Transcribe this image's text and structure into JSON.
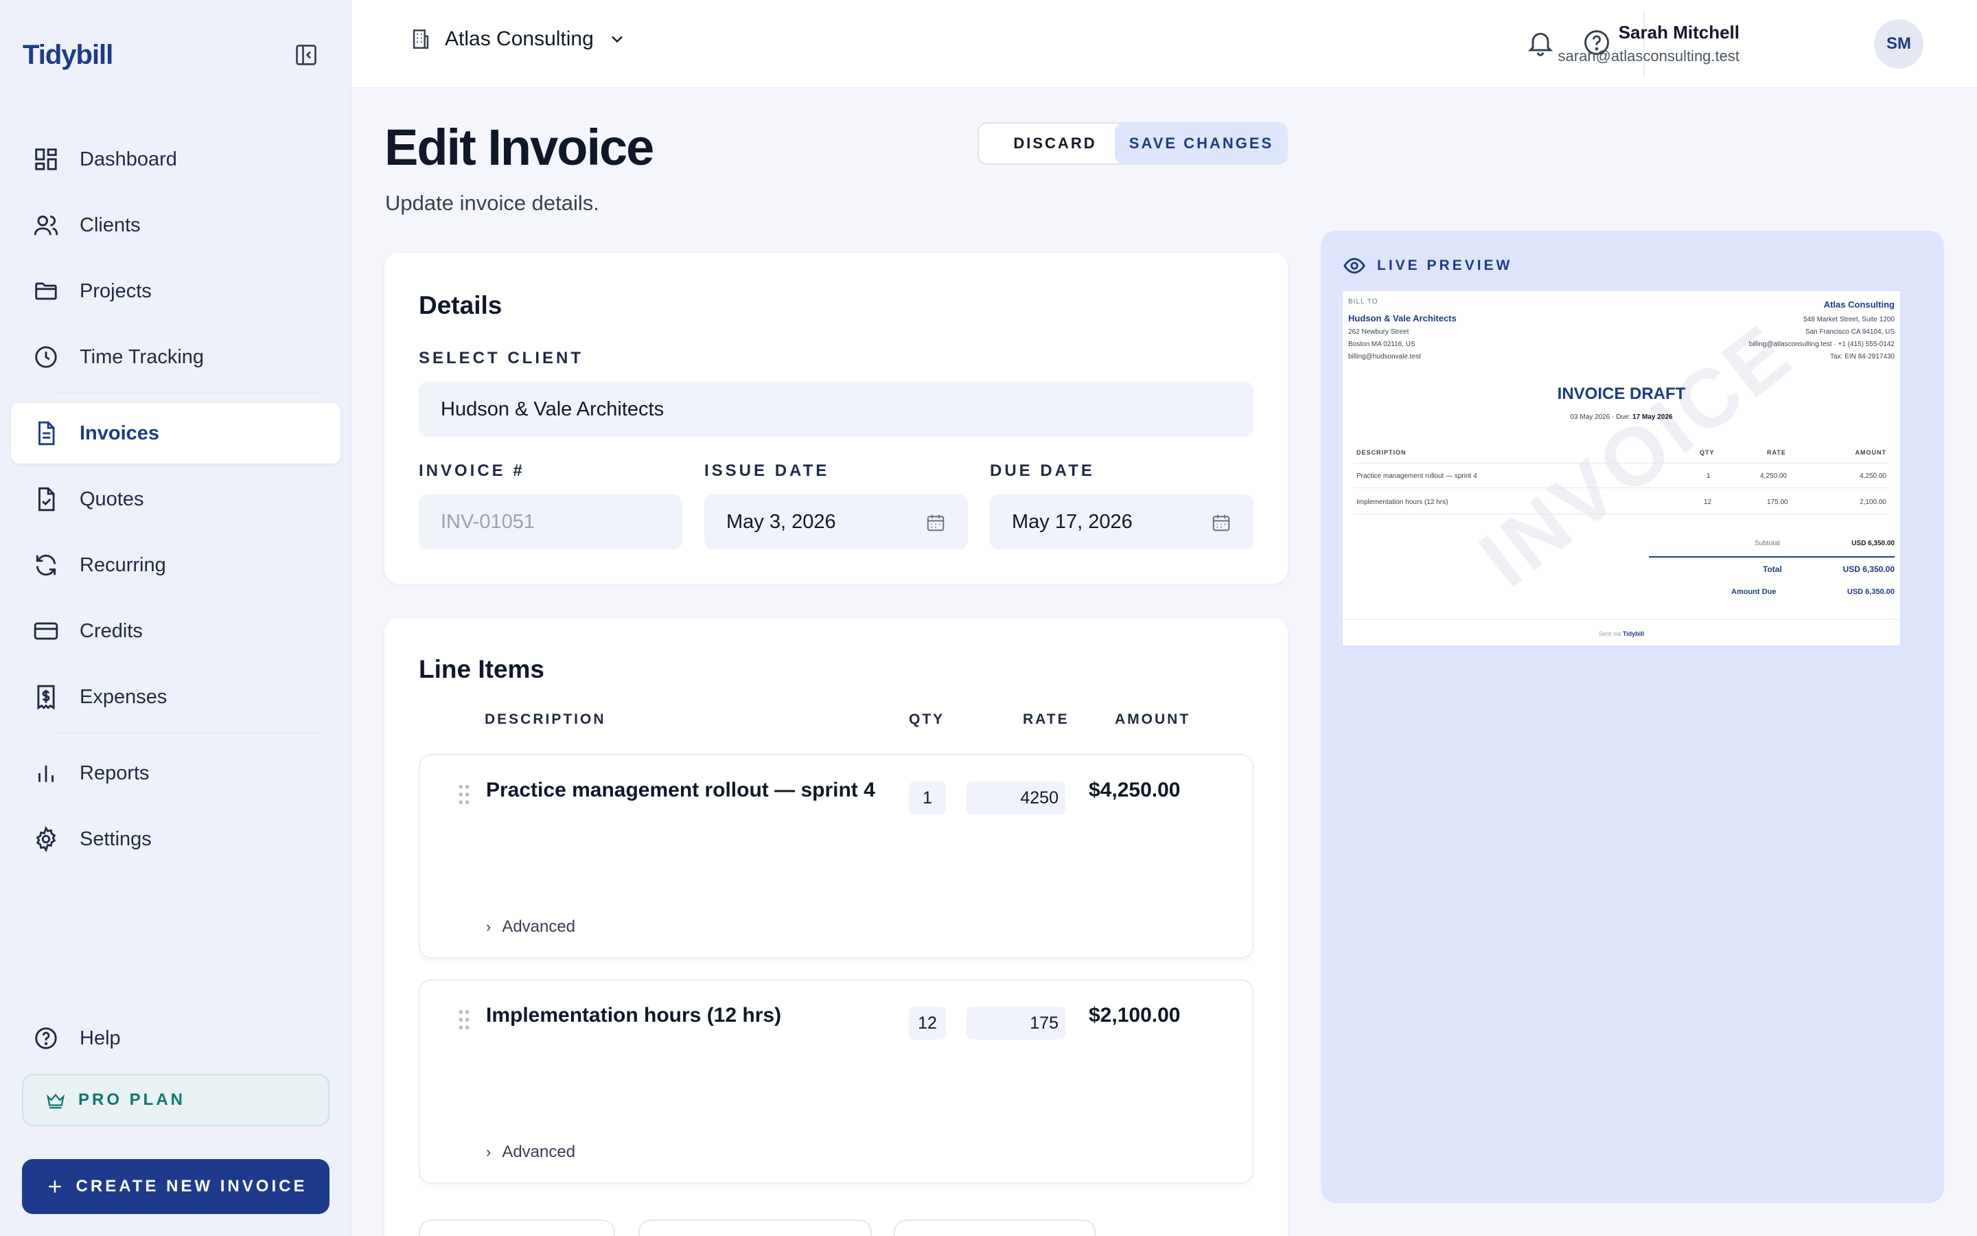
{
  "brand": "Tidybill",
  "sidebar": {
    "items": [
      {
        "label": "Dashboard",
        "icon": "dashboard-icon"
      },
      {
        "label": "Clients",
        "icon": "users-icon"
      },
      {
        "label": "Projects",
        "icon": "folder-icon"
      },
      {
        "label": "Time Tracking",
        "icon": "clock-icon"
      },
      {
        "label": "Invoices",
        "icon": "file-text-icon",
        "active": true
      },
      {
        "label": "Quotes",
        "icon": "file-check-icon"
      },
      {
        "label": "Recurring",
        "icon": "refresh-icon"
      },
      {
        "label": "Credits",
        "icon": "credit-card-icon"
      },
      {
        "label": "Expenses",
        "icon": "receipt-dollar-icon"
      },
      {
        "label": "Reports",
        "icon": "bar-chart-icon"
      },
      {
        "label": "Settings",
        "icon": "gear-icon"
      }
    ],
    "help": "Help",
    "pro_plan": "PRO PLAN",
    "create_button": "CREATE NEW INVOICE"
  },
  "topbar": {
    "workspace": "Atlas Consulting",
    "user_name": "Sarah Mitchell",
    "user_email": "sarah@atlasconsulting.test",
    "avatar_initials": "SM"
  },
  "page": {
    "title": "Edit Invoice",
    "subtitle": "Update invoice details.",
    "discard": "DISCARD",
    "save": "SAVE CHANGES"
  },
  "details": {
    "title": "Details",
    "client_label": "SELECT CLIENT",
    "client_value": "Hudson & Vale Architects",
    "invoice_label": "INVOICE #",
    "invoice_placeholder": "INV-01051",
    "issue_label": "ISSUE DATE",
    "issue_value": "May 3, 2026",
    "due_label": "DUE DATE",
    "due_value": "May 17, 2026"
  },
  "line_items": {
    "title": "Line Items",
    "headers": {
      "description": "DESCRIPTION",
      "qty": "QTY",
      "rate": "RATE",
      "amount": "AMOUNT"
    },
    "advanced_label": "Advanced",
    "rows": [
      {
        "description": "Practice management rollout — sprint 4",
        "qty": "1",
        "rate": "4250",
        "amount": "$4,250.00"
      },
      {
        "description": "Implementation hours (12 hrs)",
        "qty": "12",
        "rate": "175",
        "amount": "$2,100.00"
      }
    ]
  },
  "preview": {
    "label": "LIVE PREVIEW",
    "bill_to_label": "BILL TO",
    "client_name": "Hudson & Vale Architects",
    "client_address1": "262 Newbury Street",
    "client_address2": "Boston MA 02116, US",
    "client_email": "billing@hudsonvale.test",
    "company_name": "Atlas Consulting",
    "company_address1": "548 Market Street, Suite 1200",
    "company_address2": "San Francisco CA 94104, US",
    "company_contact": "billing@atlasconsulting.test · +1 (415) 555-0142",
    "company_tax": "Tax: EIN 84-2917430",
    "doc_title": "INVOICE DRAFT",
    "issue_short": "03 May 2026",
    "due_prefix": "· Due:",
    "due_short": "17 May 2026",
    "watermark": "INVOICE",
    "headers": {
      "description": "DESCRIPTION",
      "qty": "QTY",
      "rate": "RATE",
      "amount": "AMOUNT"
    },
    "rows": [
      {
        "description": "Practice management rollout — sprint 4",
        "qty": "1",
        "rate": "4,250.00",
        "amount": "4,250.00"
      },
      {
        "description": "Implementation hours (12 hrs)",
        "qty": "12",
        "rate": "175.00",
        "amount": "2,100.00"
      }
    ],
    "subtotal_label": "Subtotal",
    "subtotal_value": "USD 6,350.00",
    "total_label": "Total",
    "total_value": "USD 6,350.00",
    "amount_due_label": "Amount Due",
    "amount_due_value": "USD 6,350.00",
    "footer_prefix": "Sent via",
    "footer_brand": "Tidybill"
  }
}
